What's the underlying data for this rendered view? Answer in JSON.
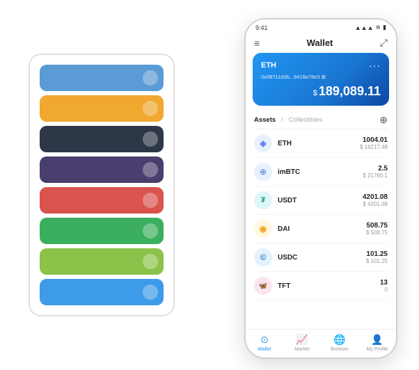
{
  "scene": {
    "card_stack": {
      "items": [
        {
          "color": "#5B9BD5",
          "dot_color": "rgba(255,255,255,0.4)"
        },
        {
          "color": "#F0A830",
          "dot_color": "rgba(255,255,255,0.4)"
        },
        {
          "color": "#2D3748",
          "dot_color": "rgba(255,255,255,0.4)"
        },
        {
          "color": "#4A3E6E",
          "dot_color": "rgba(255,255,255,0.4)"
        },
        {
          "color": "#D9534F",
          "dot_color": "rgba(255,255,255,0.4)"
        },
        {
          "color": "#3BAF5E",
          "dot_color": "rgba(255,255,255,0.4)"
        },
        {
          "color": "#8BC34A",
          "dot_color": "rgba(255,255,255,0.4)"
        },
        {
          "color": "#3D9BE9",
          "dot_color": "rgba(255,255,255,0.4)"
        }
      ]
    },
    "phone": {
      "status_bar": {
        "time": "9:41",
        "signal": "▲",
        "wifi": "WiFi",
        "battery": "🔋"
      },
      "header": {
        "menu_icon": "≡",
        "title": "Wallet",
        "expand_icon": "⤢"
      },
      "eth_card": {
        "label": "ETH",
        "dots": "···",
        "address": "0x08711d3b...8418a78e3  ⊞",
        "currency_symbol": "$",
        "balance": "189,089.11"
      },
      "assets_section": {
        "tab_active": "Assets",
        "tab_separator": "/",
        "tab_inactive": "Collectibles",
        "add_icon": "⊕"
      },
      "asset_list": [
        {
          "name": "ETH",
          "icon": "◈",
          "icon_bg": "#E8F0FE",
          "icon_color": "#5C7CFF",
          "amount": "1004.01",
          "usd": "$ 16217.48"
        },
        {
          "name": "imBTC",
          "icon": "⊕",
          "icon_bg": "#E8F0FE",
          "icon_color": "#3D7CCA",
          "amount": "2.5",
          "usd": "$ 21760.1"
        },
        {
          "name": "USDT",
          "icon": "₮",
          "icon_bg": "#E0F7FA",
          "icon_color": "#26A17B",
          "amount": "4201.08",
          "usd": "$ 4201.08"
        },
        {
          "name": "DAI",
          "icon": "◎",
          "icon_bg": "#FFF8E1",
          "icon_color": "#F5A623",
          "amount": "508.75",
          "usd": "$ 508.75"
        },
        {
          "name": "USDC",
          "icon": "©",
          "icon_bg": "#E3F2FD",
          "icon_color": "#2775CA",
          "amount": "101.25",
          "usd": "$ 101.25"
        },
        {
          "name": "TFT",
          "icon": "🦋",
          "icon_bg": "#FCE4EC",
          "icon_color": "#E91E63",
          "amount": "13",
          "usd": "0"
        }
      ],
      "bottom_nav": [
        {
          "label": "Wallet",
          "icon": "⊙",
          "active": true
        },
        {
          "label": "Market",
          "icon": "📊",
          "active": false
        },
        {
          "label": "Browser",
          "icon": "👤",
          "active": false
        },
        {
          "label": "My Profile",
          "icon": "👤",
          "active": false
        }
      ]
    }
  }
}
